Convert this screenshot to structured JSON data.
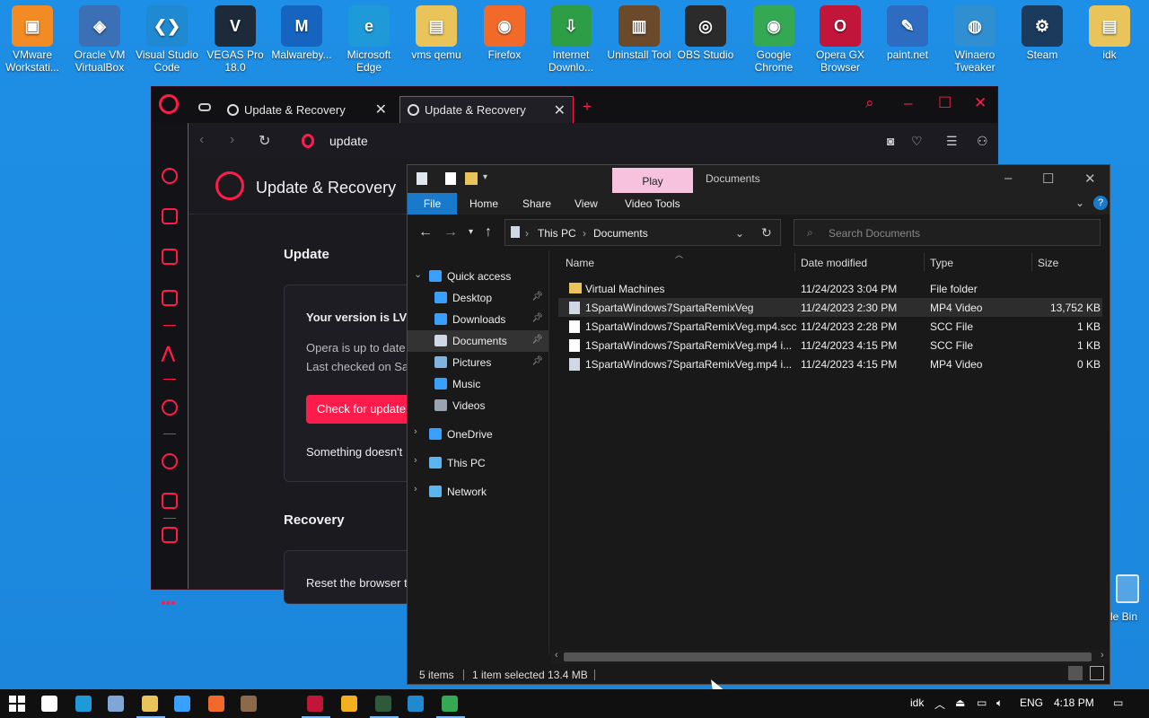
{
  "desktop": {
    "icons": [
      {
        "label": "VMware Workstati...",
        "color": "#f28b24",
        "glyph": "▣",
        "icon": "vmware-icon"
      },
      {
        "label": "Oracle VM VirtualBox",
        "color": "#3b6fb6",
        "glyph": "◈",
        "icon": "virtualbox-icon"
      },
      {
        "label": "Visual Studio Code",
        "color": "#1f8ad2",
        "glyph": "❮❯",
        "icon": "vscode-icon"
      },
      {
        "label": "VEGAS Pro 18.0",
        "color": "#1c2a3a",
        "glyph": "V",
        "icon": "vegas-icon"
      },
      {
        "label": "Malwareby...",
        "color": "#1565c0",
        "glyph": "M",
        "icon": "malwarebytes-icon"
      },
      {
        "label": "Microsoft Edge",
        "color": "#1f9ad8",
        "glyph": "e",
        "icon": "edge-icon"
      },
      {
        "label": "vms qemu",
        "color": "#e8c45a",
        "glyph": "▤",
        "icon": "folder-icon"
      },
      {
        "label": "Firefox",
        "color": "#f26a2a",
        "glyph": "◉",
        "icon": "firefox-icon"
      },
      {
        "label": "Internet Downlo...",
        "color": "#2e9e46",
        "glyph": "⇩",
        "icon": "idm-icon"
      },
      {
        "label": "Uninstall Tool",
        "color": "#6b4a2b",
        "glyph": "▥",
        "icon": "uninstall-tool-icon"
      },
      {
        "label": "OBS Studio",
        "color": "#2b2b2b",
        "glyph": "◎",
        "icon": "obs-icon"
      },
      {
        "label": "Google Chrome",
        "color": "#34a853",
        "glyph": "◉",
        "icon": "chrome-icon"
      },
      {
        "label": "Opera GX Browser",
        "color": "#c2153a",
        "glyph": "O",
        "icon": "opera-gx-icon"
      },
      {
        "label": "paint.net",
        "color": "#2d6cc0",
        "glyph": "✎",
        "icon": "paintnet-icon"
      },
      {
        "label": "Winaero Tweaker",
        "color": "#2f8fd0",
        "glyph": "◍",
        "icon": "winaero-icon"
      },
      {
        "label": "Steam",
        "color": "#1b3a5c",
        "glyph": "⚙",
        "icon": "steam-icon"
      },
      {
        "label": "idk",
        "color": "#e8c45a",
        "glyph": "▤",
        "icon": "folder-icon"
      }
    ],
    "recycle_bin_label": "le Bin"
  },
  "opera": {
    "tabs": [
      {
        "label": "Update & Recovery",
        "active": false
      },
      {
        "label": "Update & Recovery",
        "active": true
      }
    ],
    "new_tab": "+",
    "address": "update",
    "page_title": "Update & Recovery",
    "update_heading": "Update",
    "version_text": "Your version is  LV",
    "status_line1": "Opera is up to date",
    "status_line2": "Last checked on Sat",
    "check_button": "Check for update",
    "feedback_text": "Something doesn't",
    "recovery_heading": "Recovery",
    "recovery_text": "Reset the browser to",
    "accent": "#ff1b4a"
  },
  "explorer": {
    "play_tab": "Play",
    "title": "Documents",
    "menu": {
      "file": "File",
      "home": "Home",
      "share": "Share",
      "view": "View",
      "video_tools": "Video Tools"
    },
    "path": {
      "this_pc": "This PC",
      "documents": "Documents"
    },
    "search_placeholder": "Search Documents",
    "nav": [
      {
        "label": "Quick access",
        "icon": "star-icon",
        "color": "#3aa0ff",
        "indent": 0,
        "pinned": false,
        "selected": false,
        "expand": true
      },
      {
        "label": "Desktop",
        "icon": "desktop-icon",
        "color": "#3aa0ff",
        "indent": 1,
        "pinned": true,
        "selected": false,
        "expand": false
      },
      {
        "label": "Downloads",
        "icon": "download-icon",
        "color": "#3aa0ff",
        "indent": 1,
        "pinned": true,
        "selected": false,
        "expand": false
      },
      {
        "label": "Documents",
        "icon": "document-icon",
        "color": "#cfd8e3",
        "indent": 1,
        "pinned": true,
        "selected": true,
        "expand": false
      },
      {
        "label": "Pictures",
        "icon": "pictures-icon",
        "color": "#7fb3e0",
        "indent": 1,
        "pinned": true,
        "selected": false,
        "expand": false
      },
      {
        "label": "Music",
        "icon": "music-icon",
        "color": "#3aa0ff",
        "indent": 1,
        "pinned": false,
        "selected": false,
        "expand": false
      },
      {
        "label": "Videos",
        "icon": "videos-icon",
        "color": "#9aa4b0",
        "indent": 1,
        "pinned": false,
        "selected": false,
        "expand": false
      },
      {
        "label": "OneDrive",
        "icon": "onedrive-icon",
        "color": "#3aa0ff",
        "indent": 0,
        "pinned": false,
        "selected": false,
        "expand": true
      },
      {
        "label": "This PC",
        "icon": "this-pc-icon",
        "color": "#5bb6f0",
        "indent": 0,
        "pinned": false,
        "selected": false,
        "expand": true
      },
      {
        "label": "Network",
        "icon": "network-icon",
        "color": "#5bb6f0",
        "indent": 0,
        "pinned": false,
        "selected": false,
        "expand": true
      }
    ],
    "columns": {
      "name": "Name",
      "date": "Date modified",
      "type": "Type",
      "size": "Size"
    },
    "files": [
      {
        "name": "Virtual Machines",
        "date": "11/24/2023 3:04 PM",
        "type": "File folder",
        "size": "",
        "icon": "folder-icon",
        "color": "#e8c45a",
        "selected": false
      },
      {
        "name": "1SpartaWindows7SpartaRemixVeg",
        "date": "11/24/2023 2:30 PM",
        "type": "MP4 Video",
        "size": "13,752 KB",
        "icon": "video-file-icon",
        "color": "#cfd8e3",
        "selected": true
      },
      {
        "name": "1SpartaWindows7SpartaRemixVeg.mp4.scc",
        "date": "11/24/2023 2:28 PM",
        "type": "SCC File",
        "size": "1 KB",
        "icon": "file-icon",
        "color": "#ffffff",
        "selected": false
      },
      {
        "name": "1SpartaWindows7SpartaRemixVeg.mp4 i...",
        "date": "11/24/2023 4:15 PM",
        "type": "SCC File",
        "size": "1 KB",
        "icon": "file-icon",
        "color": "#ffffff",
        "selected": false
      },
      {
        "name": "1SpartaWindows7SpartaRemixVeg.mp4 i...",
        "date": "11/24/2023 4:15 PM",
        "type": "MP4 Video",
        "size": "0 KB",
        "icon": "video-file-icon",
        "color": "#cfd8e3",
        "selected": false
      }
    ],
    "status": {
      "items": "5 items",
      "selected": "1 item selected  13.4 MB"
    }
  },
  "taskbar": {
    "apps": [
      {
        "icon": "windows-start-icon",
        "color": "#ffffff"
      },
      {
        "icon": "search-icon",
        "color": "#ffffff"
      },
      {
        "icon": "edge-icon",
        "color": "#1f9ad8"
      },
      {
        "icon": "task-manager-icon",
        "color": "#7fa6d6"
      },
      {
        "icon": "file-explorer-icon",
        "color": "#e8c45a"
      },
      {
        "icon": "store-icon",
        "color": "#3aa0ff"
      },
      {
        "icon": "firefox-icon",
        "color": "#f26a2a"
      },
      {
        "icon": "uninstall-tool-icon",
        "color": "#8a6a4a"
      },
      {
        "icon": "opera-gx-icon",
        "color": "#c2153a"
      },
      {
        "icon": "grid-app-icon",
        "color": "#f2b01e"
      },
      {
        "icon": "vegas-icon",
        "color": "#2d5a3a"
      },
      {
        "icon": "vscode-icon",
        "color": "#1f8ad2"
      },
      {
        "icon": "chrome-icon",
        "color": "#34a853"
      }
    ],
    "tray_label": "idk",
    "language": "ENG",
    "time": "4:18 PM"
  }
}
